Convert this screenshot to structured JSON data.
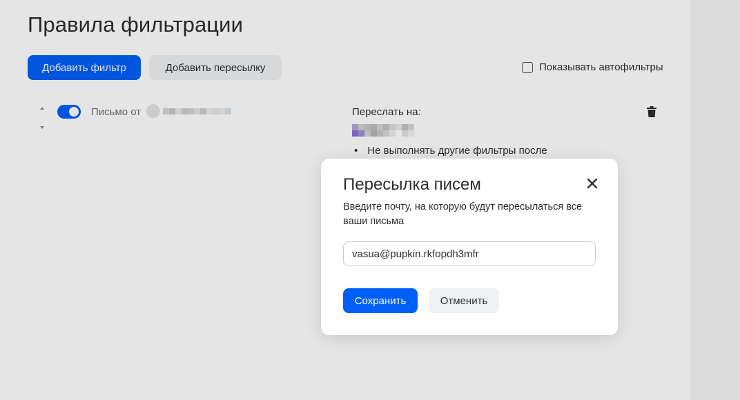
{
  "page": {
    "title": "Правила фильтрации",
    "add_filter_label": "Добавить фильтр",
    "add_forward_label": "Добавить пересылку",
    "show_autofilters_label": "Показывать автофильтры",
    "show_autofilters_checked": false
  },
  "rule": {
    "enabled": true,
    "condition_label": "Письмо от",
    "action_label": "Переслать на:",
    "bullet": "Не выполнять другие фильтры после",
    "icons": [
      "arrow-up-icon",
      "arrow-down-icon",
      "trash-icon"
    ]
  },
  "modal": {
    "title": "Пересылка писем",
    "description": "Введите почту, на которую будут пересылаться все ваши письма",
    "input_value": "vasua@pupkin.rkfopdh3mfr",
    "save_label": "Сохранить",
    "cancel_label": "Отменить",
    "close_icon": "close-icon"
  },
  "colors": {
    "accent": "#005ff9",
    "text": "#2c2d2e",
    "secondary_button": "#f0f1f3"
  }
}
